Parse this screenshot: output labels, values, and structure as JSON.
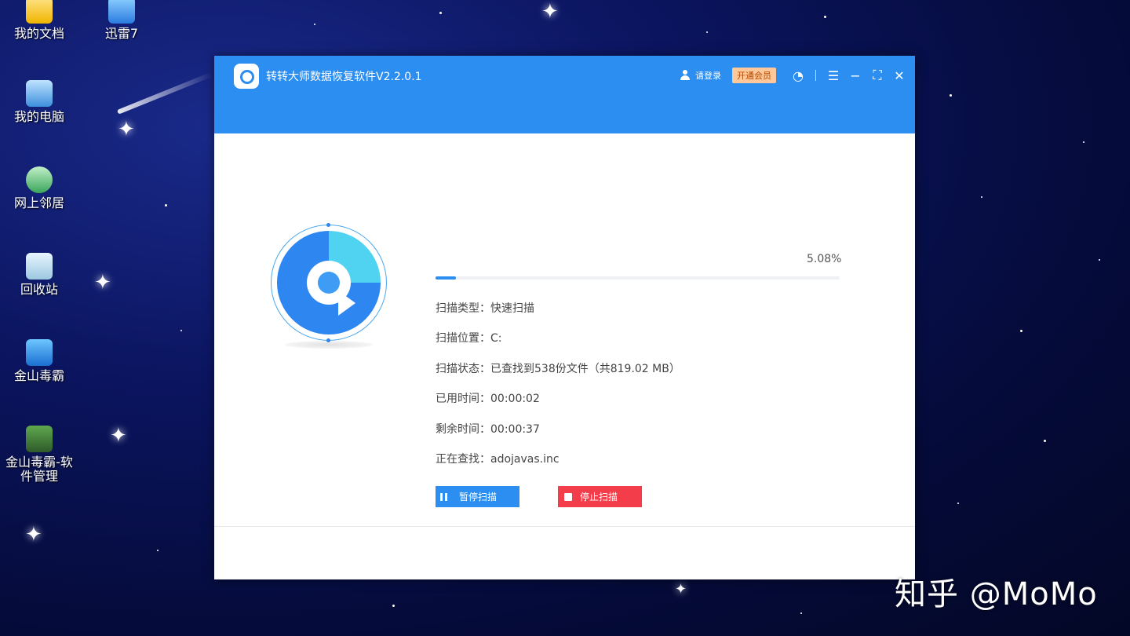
{
  "desktop": {
    "icons": [
      {
        "label": "我的文档"
      },
      {
        "label": "迅雷7"
      },
      {
        "label": "我的电脑"
      },
      {
        "label": "网上邻居"
      },
      {
        "label": "回收站"
      },
      {
        "label": "金山毒霸"
      },
      {
        "label": "金山毒霸-软件管理"
      }
    ]
  },
  "window": {
    "title": "转转大师数据恢复软件V2.2.0.1",
    "login_label": "请登录",
    "vip_label": "开通会员",
    "accent_color": "#2b8ef0"
  },
  "scan": {
    "progress_text": "5.08%",
    "progress_value": 0.0508,
    "type": "扫描类型：快速扫描",
    "location": "扫描位置：C:",
    "status": "扫描状态：已查找到538份文件（共819.02 MB）",
    "elapsed": "已用时间：00:00:02",
    "remaining": "剩余时间：00:00:37",
    "current": "正在查找：adojavas.inc",
    "pause_label": "暂停扫描",
    "stop_label": "停止扫描"
  },
  "watermark": "知乎 @MoMo"
}
